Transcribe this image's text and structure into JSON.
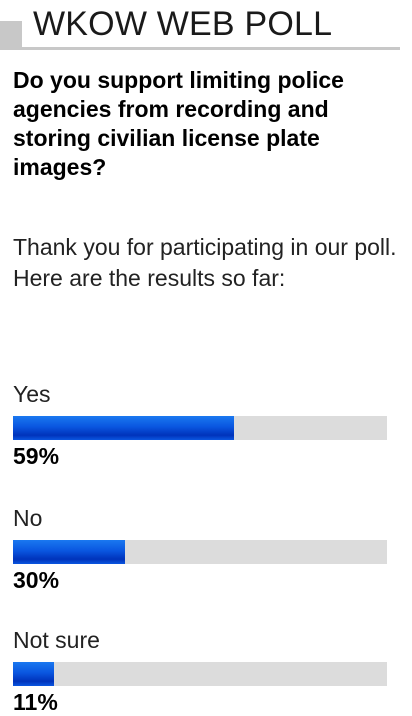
{
  "header": {
    "title": "WKOW WEB POLL"
  },
  "poll": {
    "question": "Do you support limiting police agencies from recording and storing civilian license plate images?",
    "message": "Thank you for participating in our poll. Here are the results so far:",
    "options": [
      {
        "label": "Yes",
        "percent_label": "59%",
        "fraction": 0.59
      },
      {
        "label": "No",
        "percent_label": "30%",
        "fraction": 0.3
      },
      {
        "label": "Not sure",
        "percent_label": "11%",
        "fraction": 0.11
      }
    ]
  },
  "colors": {
    "bar_fill": "#0a56e0",
    "bar_track": "#dcdcdc",
    "header_accent": "#c8c8c8"
  }
}
